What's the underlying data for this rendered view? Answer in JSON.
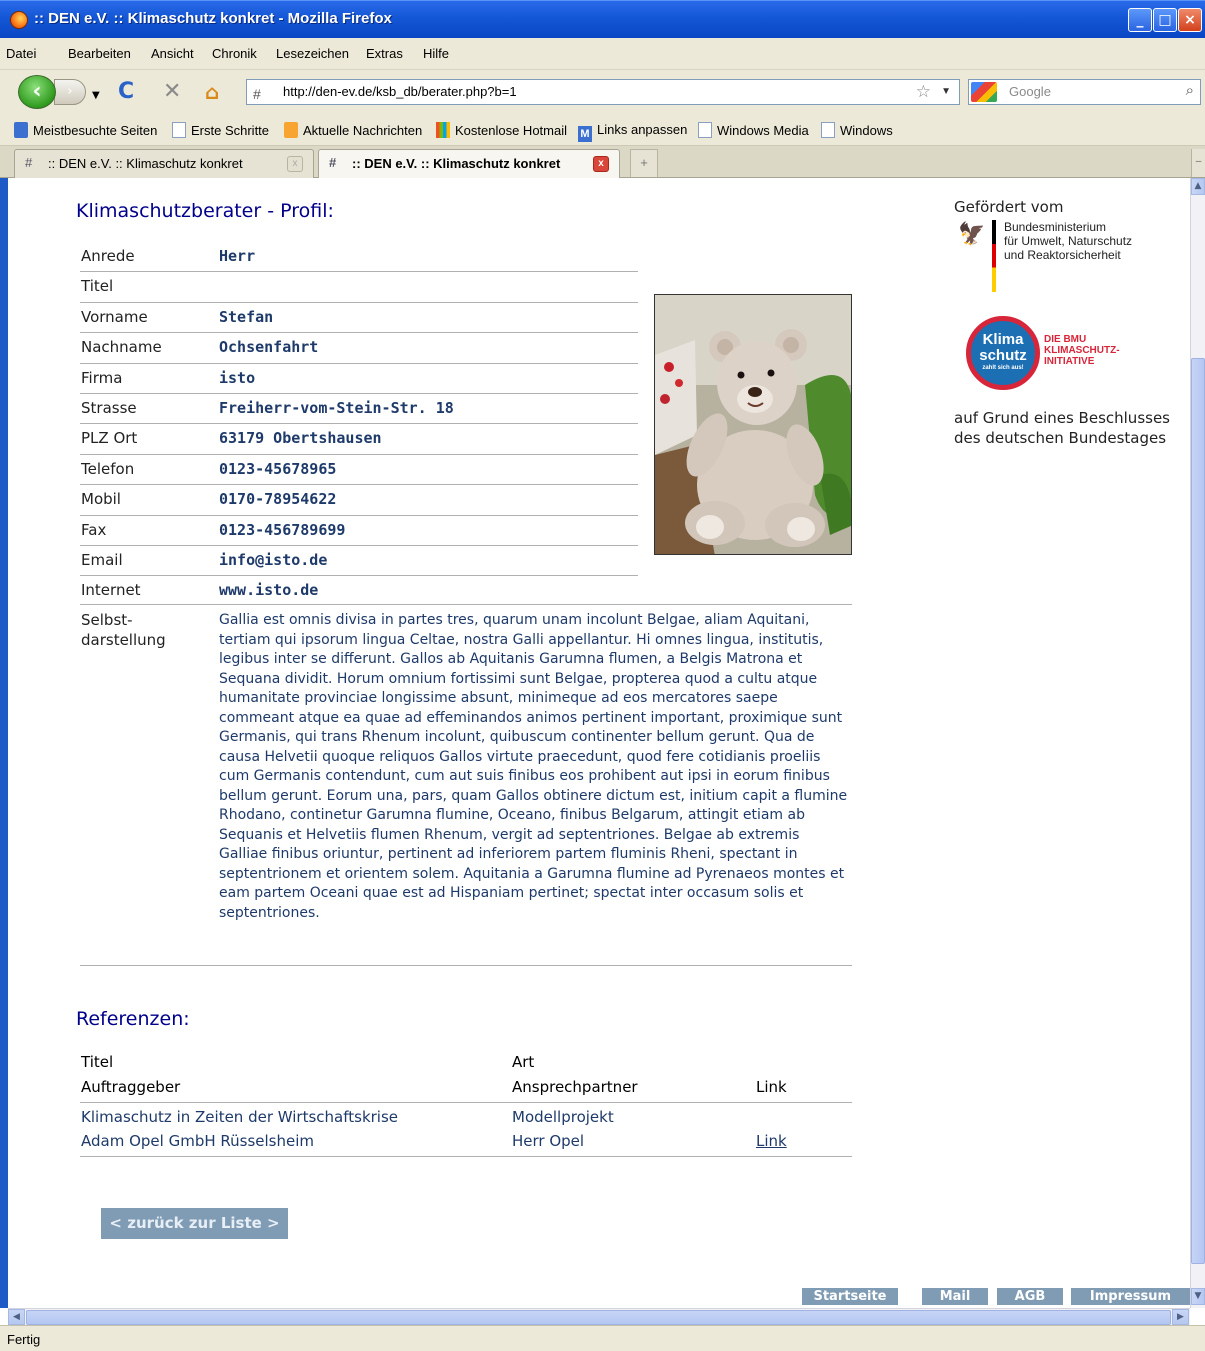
{
  "window": {
    "title": ":: DEN e.V. :: Klimaschutz konkret - Mozilla Firefox"
  },
  "menu": [
    "Datei",
    "Bearbeiten",
    "Ansicht",
    "Chronik",
    "Lesezeichen",
    "Extras",
    "Hilfe"
  ],
  "address": {
    "url": "http://den-ev.de/ksb_db/berater.php?b=1"
  },
  "search": {
    "placeholder": "Google"
  },
  "bookmarks": [
    "Meistbesuchte Seiten",
    "Erste Schritte",
    "Aktuelle Nachrichten",
    "Kostenlose Hotmail",
    "Links anpassen",
    "Windows Media",
    "Windows"
  ],
  "tabs": [
    {
      "title": ":: DEN e.V. :: Klimaschutz konkret"
    },
    {
      "title": ":: DEN e.V. :: Klimaschutz konkret"
    }
  ],
  "profile": {
    "heading": "Klimaschutzberater - Profil:",
    "rows": [
      {
        "label": "Anrede",
        "value": "Herr"
      },
      {
        "label": "Titel",
        "value": ""
      },
      {
        "label": "Vorname",
        "value": "Stefan"
      },
      {
        "label": "Nachname",
        "value": "Ochsenfahrt"
      },
      {
        "label": "Firma",
        "value": "isto"
      },
      {
        "label": "Strasse",
        "value": "Freiherr-vom-Stein-Str. 18"
      },
      {
        "label": "PLZ Ort",
        "value": "63179 Obertshausen"
      },
      {
        "label": "Telefon",
        "value": "0123-45678965"
      },
      {
        "label": "Mobil",
        "value": "0170-78954622"
      },
      {
        "label": "Fax",
        "value": "0123-456789699"
      },
      {
        "label": "Email",
        "value": "info@isto.de"
      },
      {
        "label": "Internet",
        "value": "www.isto.de"
      }
    ],
    "self_label": "Selbst-\ndarstellung",
    "self_text": "Gallia est omnis divisa in partes tres, quarum unam incolunt Belgae, aliam Aquitani, tertiam qui ipsorum lingua Celtae, nostra Galli appellantur. Hi omnes lingua, institutis, legibus inter se differunt. Gallos ab Aquitanis Garumna flumen, a Belgis Matrona et Sequana dividit. Horum omnium fortissimi sunt Belgae, propterea quod a cultu atque humanitate provinciae longissime absunt, minimeque ad eos mercatores saepe commeant atque ea quae ad effeminandos animos pertinent important, proximique sunt Germanis, qui trans Rhenum incolunt, quibuscum continenter bellum gerunt. Qua de causa Helvetii quoque reliquos Gallos virtute praecedunt, quod fere cotidianis proeliis cum Germanis contendunt, cum aut suis finibus eos prohibent aut ipsi in eorum finibus bellum gerunt. Eorum una, pars, quam Gallos obtinere dictum est, initium capit a flumine Rhodano, continetur Garumna flumine, Oceano, finibus Belgarum, attingit etiam ab Sequanis et Helvetiis flumen Rhenum, vergit ad septentriones. Belgae ab extremis Galliae finibus oriuntur, pertinent ad inferiorem partem fluminis Rheni, spectant in septentrionem et orientem solem. Aquitania a Garumna flumine ad Pyrenaeos montes et eam partem Oceani quae est ad Hispaniam pertinet; spectat inter occasum solis et septentriones."
  },
  "references": {
    "heading": "Referenzen:",
    "col_titel": "Titel",
    "col_art": "Art",
    "col_auftraggeber": "Auftraggeber",
    "col_ansprechpartner": "Ansprechpartner",
    "col_link": "Link",
    "entry": {
      "titel": "Klimaschutz in Zeiten der Wirtschaftskrise",
      "art": "Modellprojekt",
      "auftraggeber": "Adam Opel GmbH Rüsselsheim",
      "ansprechpartner": "Herr Opel",
      "link": "Link"
    }
  },
  "back_button": "< zurück zur Liste >",
  "sidebar": {
    "gefoerdert": "Gefördert vom",
    "ministry": [
      "Bundesministerium",
      "für Umwelt, Naturschutz",
      "und Reaktorsicherheit"
    ],
    "badge_line1": "Klima",
    "badge_line2": "schutz",
    "badge_small": "zahlt sich aus!",
    "initiative": [
      "DIE BMU",
      "KLIMASCHUTZ-",
      "INITIATIVE"
    ],
    "beschluss": "auf Grund eines Beschlusses des deutschen Bundestages"
  },
  "footer": [
    "Startseite",
    "Mail",
    "AGB",
    "Impressum"
  ],
  "status": "Fertig",
  "colors": {
    "heading": "#00008b",
    "value": "#1e3a6a",
    "button": "#7f9cb4",
    "titlebar": "#1457d6"
  }
}
